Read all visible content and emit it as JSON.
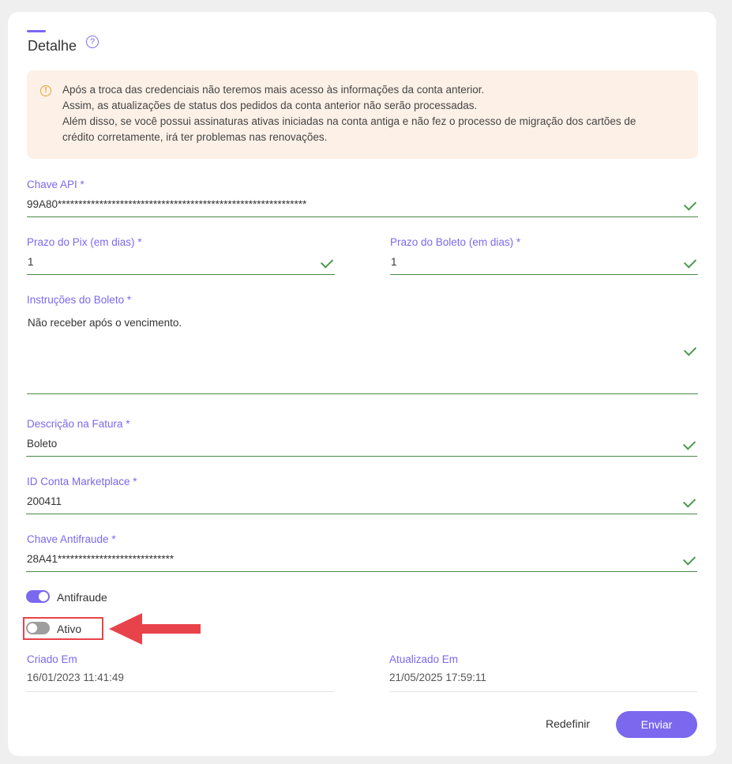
{
  "header": {
    "title": "Detalhe",
    "help_icon": "question-circle-icon"
  },
  "alert": {
    "icon": "warning-circle-icon",
    "lines": [
      "Após a troca das credenciais não teremos mais acesso às informações da conta anterior.",
      "Assim, as atualizações de status dos pedidos da conta anterior não serão processadas.",
      "Além disso, se você possui assinaturas ativas iniciadas na conta antiga e não fez o processo de migração dos cartões de",
      "crédito corretamente, irá ter problemas nas renovações."
    ]
  },
  "form": {
    "api_key": {
      "label": "Chave API *",
      "value": "99A80************************************************************"
    },
    "pix_days": {
      "label": "Prazo do Pix (em dias) *",
      "value": "1"
    },
    "boleto_days": {
      "label": "Prazo do Boleto (em dias) *",
      "value": "1"
    },
    "boleto_instructions": {
      "label": "Instruções do Boleto *",
      "value": "Não receber após o vencimento."
    },
    "invoice_description": {
      "label": "Descrição na Fatura *",
      "value": "Boleto"
    },
    "marketplace_id": {
      "label": "ID Conta Marketplace *",
      "value": "200411"
    },
    "antifraud_key": {
      "label": "Chave Antifraude *",
      "value": "28A41****************************"
    }
  },
  "toggles": {
    "antifraude": {
      "label": "Antifraude",
      "on": true
    },
    "ativo": {
      "label": "Ativo",
      "on": false
    }
  },
  "meta": {
    "created": {
      "label": "Criado Em",
      "value": "16/01/2023 11:41:49"
    },
    "updated": {
      "label": "Atualizado Em",
      "value": "21/05/2025 17:59:11"
    }
  },
  "actions": {
    "reset_label": "Redefinir",
    "submit_label": "Enviar"
  },
  "colors": {
    "accent": "#7b68ee",
    "valid": "#4a9a4a",
    "alert_bg": "#fdf1e7",
    "annotation": "#e8434a"
  }
}
